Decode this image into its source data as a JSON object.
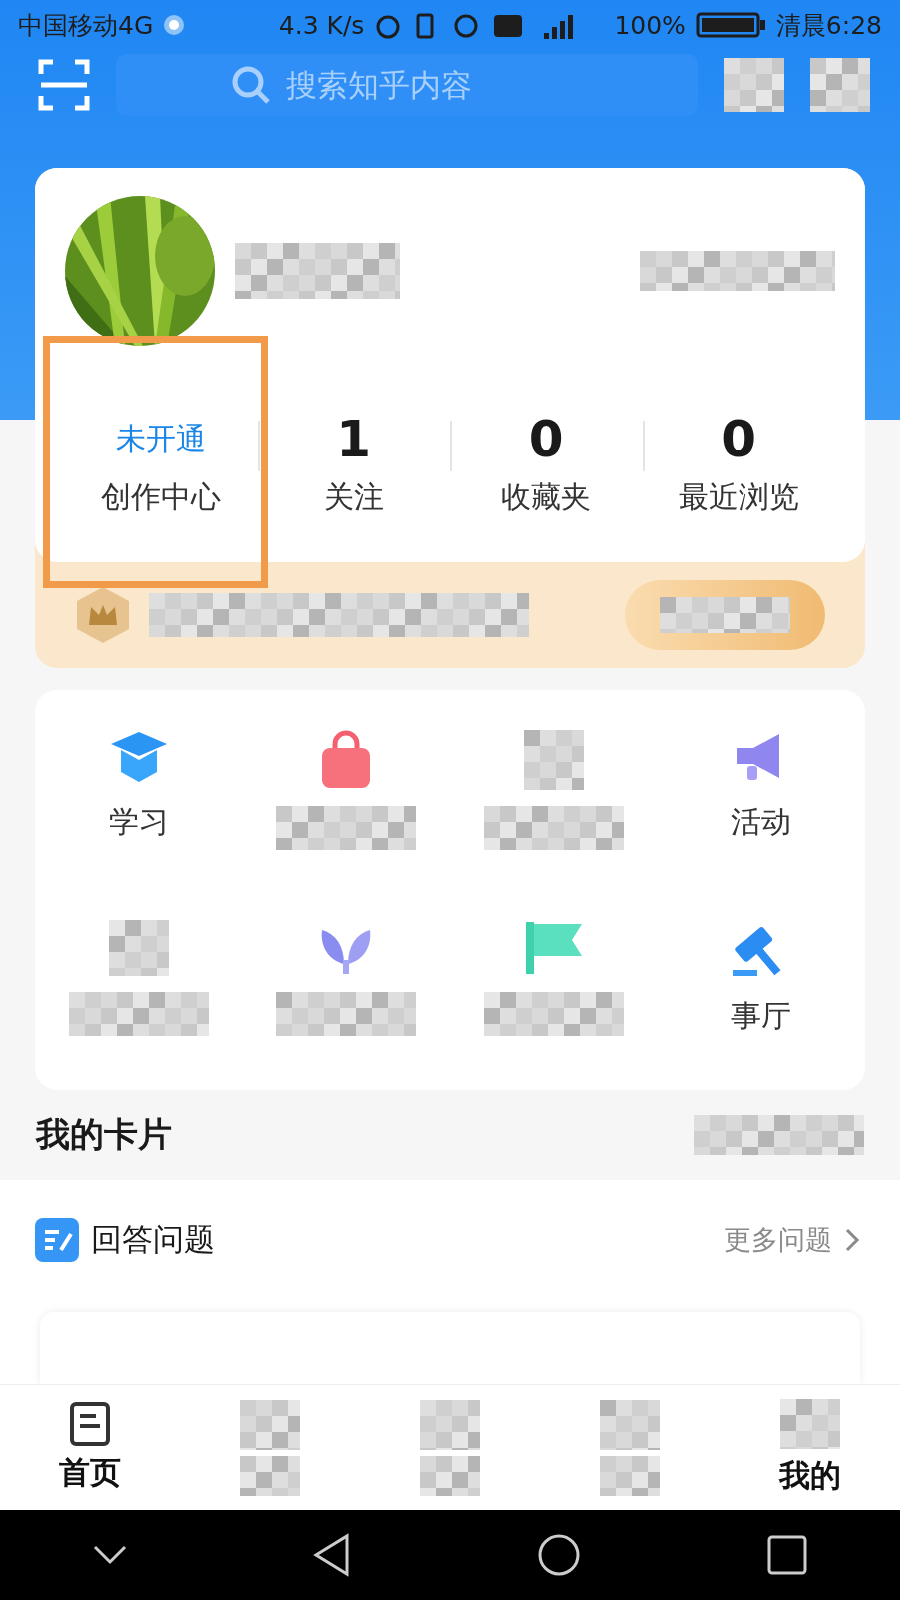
{
  "status_bar": {
    "carrier": "中国移动4G",
    "speed": "4.3 K/s",
    "battery": "100%",
    "time": "清晨6:28"
  },
  "search": {
    "placeholder": "搜索知乎内容"
  },
  "profile": {
    "stats": [
      {
        "value": "未开通",
        "label": "创作中心",
        "kind": "status",
        "highlighted": true
      },
      {
        "value": "1",
        "label": "关注",
        "kind": "count",
        "highlighted": false
      },
      {
        "value": "0",
        "label": "收藏夹",
        "kind": "count",
        "highlighted": false
      },
      {
        "value": "0",
        "label": "最近浏览",
        "kind": "count",
        "highlighted": false
      }
    ]
  },
  "tools": [
    {
      "kind": "labeled",
      "label": "学习"
    },
    {
      "kind": "redacted"
    },
    {
      "kind": "redacted"
    },
    {
      "kind": "labeled",
      "label": "活动"
    },
    {
      "kind": "redacted"
    },
    {
      "kind": "redacted"
    },
    {
      "kind": "redacted"
    },
    {
      "kind": "labeled",
      "label": "事厅"
    }
  ],
  "cards_section": {
    "title": "我的卡片"
  },
  "question_card": {
    "title": "回答问题",
    "more": "更多问题"
  },
  "tabs": [
    {
      "kind": "labeled",
      "label": "首页"
    },
    {
      "kind": "redacted"
    },
    {
      "kind": "redacted"
    },
    {
      "kind": "redacted"
    },
    {
      "kind": "labeled",
      "label": "我的"
    }
  ]
}
